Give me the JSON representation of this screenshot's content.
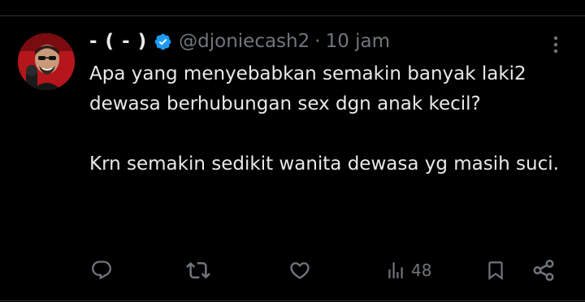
{
  "tweet": {
    "display_name": "- ( - )",
    "verified": true,
    "handle": "@djoniecash2",
    "separator": "·",
    "time": "10 jam",
    "text_paragraph_1": "Apa yang menyebabkan semakin banyak laki2 dewasa berhubungan sex dgn anak kecil?",
    "text_paragraph_2": "Krn semakin sedikit wanita dewasa yg masih suci."
  },
  "actions": {
    "reply_icon": "reply-icon",
    "retweet_icon": "retweet-icon",
    "like_icon": "heart-icon",
    "views_icon": "views-icon",
    "views_count": "48",
    "bookmark_icon": "bookmark-icon",
    "share_icon": "share-icon"
  },
  "colors": {
    "background": "#000000",
    "text": "#e7e9ea",
    "muted": "#71767b",
    "verified_badge": "#1d9bf0",
    "divider": "#2f3336"
  }
}
